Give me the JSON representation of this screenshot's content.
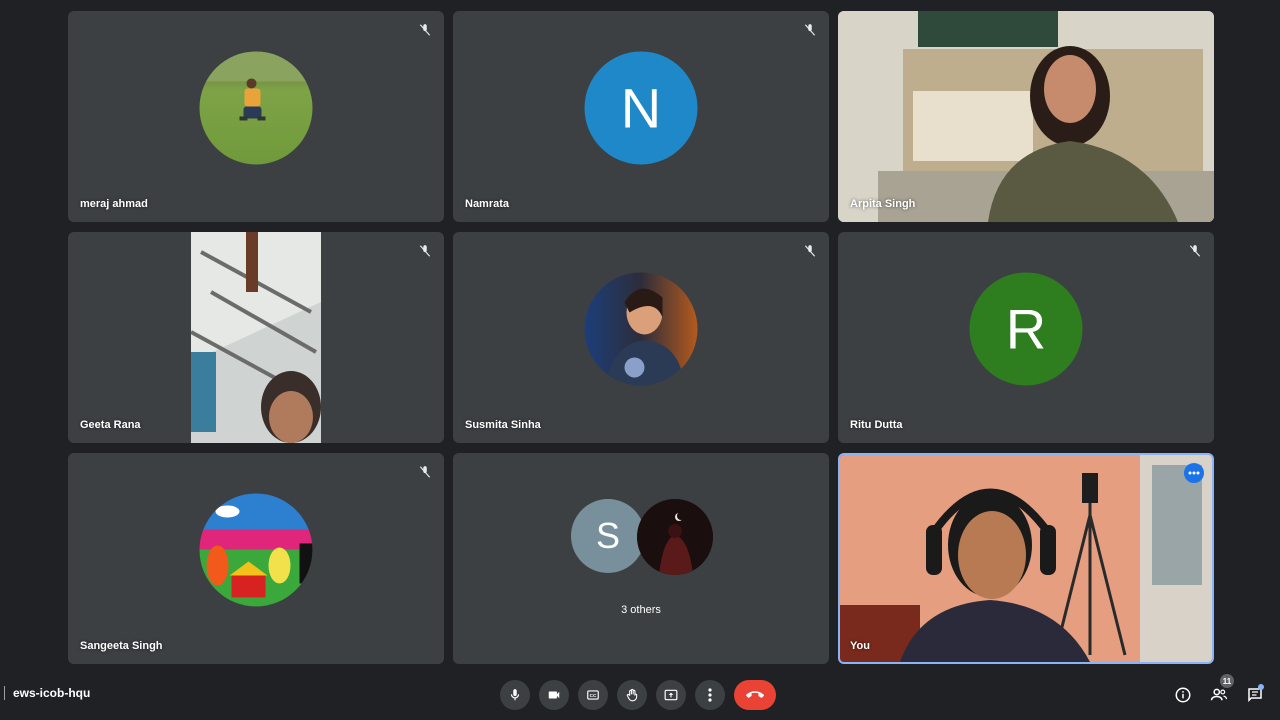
{
  "participants": [
    {
      "name": "meraj ahmad",
      "muted": true
    },
    {
      "name": "Namrata",
      "initial": "N",
      "avatar_color": "#1e88c9",
      "muted": true
    },
    {
      "name": "Arpita Singh",
      "muted": false
    },
    {
      "name": "Geeta Rana",
      "muted": true
    },
    {
      "name": "Susmita Sinha",
      "muted": true
    },
    {
      "name": "Ritu Dutta",
      "initial": "R",
      "avatar_color": "#2e7d1f",
      "muted": true
    },
    {
      "name": "Sangeeta Singh",
      "muted": true
    },
    {
      "others_initial": "S",
      "others_avatar_color": "#78909c",
      "others_label": "3 others"
    },
    {
      "name": "You",
      "active": true,
      "border_color": "#8ab4f8"
    }
  ],
  "meeting": {
    "code": "ews-icob-hqu"
  },
  "controls": {
    "end_call_color": "#ea4335",
    "people_count": "11"
  }
}
